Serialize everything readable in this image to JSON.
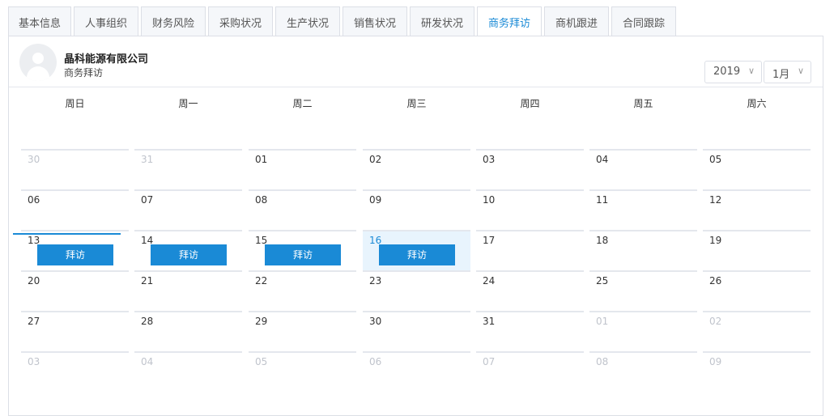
{
  "tabs": [
    {
      "label": "基本信息",
      "active": false
    },
    {
      "label": "人事组织",
      "active": false
    },
    {
      "label": "财务风险",
      "active": false
    },
    {
      "label": "采购状况",
      "active": false
    },
    {
      "label": "生产状况",
      "active": false
    },
    {
      "label": "销售状况",
      "active": false
    },
    {
      "label": "研发状况",
      "active": false
    },
    {
      "label": "商务拜访",
      "active": true
    },
    {
      "label": "商机跟进",
      "active": false
    },
    {
      "label": "合同跟踪",
      "active": false
    }
  ],
  "header": {
    "company": "晶科能源有限公司",
    "subtitle": "商务拜访"
  },
  "calendar": {
    "year": "2019",
    "month": "1月",
    "weekdays": [
      "周日",
      "周一",
      "周二",
      "周三",
      "周四",
      "周五",
      "周六"
    ],
    "event_label": "拜访",
    "days": [
      {
        "d": "30",
        "other": true
      },
      {
        "d": "31",
        "other": true
      },
      {
        "d": "01"
      },
      {
        "d": "02"
      },
      {
        "d": "03"
      },
      {
        "d": "04"
      },
      {
        "d": "05"
      },
      {
        "d": "06"
      },
      {
        "d": "07"
      },
      {
        "d": "08"
      },
      {
        "d": "09"
      },
      {
        "d": "10"
      },
      {
        "d": "11"
      },
      {
        "d": "12"
      },
      {
        "d": "13",
        "event": true
      },
      {
        "d": "14",
        "event": true
      },
      {
        "d": "15",
        "event": true
      },
      {
        "d": "16",
        "event": true,
        "selected": true
      },
      {
        "d": "17"
      },
      {
        "d": "18"
      },
      {
        "d": "19"
      },
      {
        "d": "20"
      },
      {
        "d": "21"
      },
      {
        "d": "22"
      },
      {
        "d": "23"
      },
      {
        "d": "24"
      },
      {
        "d": "25"
      },
      {
        "d": "26"
      },
      {
        "d": "27"
      },
      {
        "d": "28"
      },
      {
        "d": "29"
      },
      {
        "d": "30"
      },
      {
        "d": "31"
      },
      {
        "d": "01",
        "other": true
      },
      {
        "d": "02",
        "other": true
      },
      {
        "d": "03",
        "other": true
      },
      {
        "d": "04",
        "other": true
      },
      {
        "d": "05",
        "other": true
      },
      {
        "d": "06",
        "other": true
      },
      {
        "d": "07",
        "other": true
      },
      {
        "d": "08",
        "other": true
      },
      {
        "d": "09",
        "other": true
      }
    ]
  },
  "colors": {
    "accent": "#1a8ad6",
    "selected_bg": "#e8f4fd",
    "muted": "#c0c4cc"
  }
}
